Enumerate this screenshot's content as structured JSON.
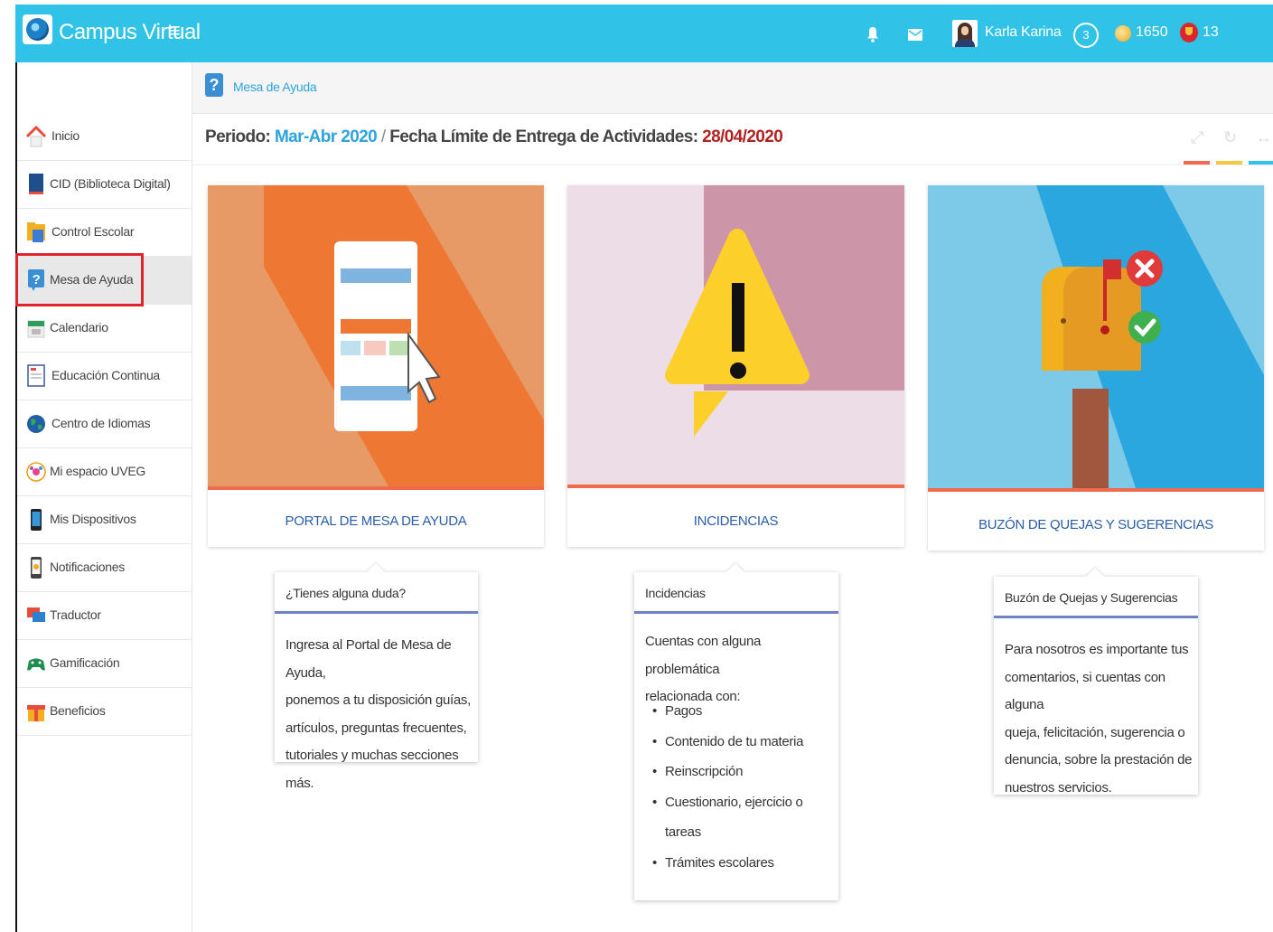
{
  "header": {
    "app_title": "Campus Virtual",
    "user_name": "Karla Karina",
    "level": "3",
    "coins": "1650",
    "trophies": "13"
  },
  "sidebar": {
    "items": [
      {
        "label": "Inicio",
        "icon": "home-icon"
      },
      {
        "label": "CID (Biblioteca Digital)",
        "icon": "book-icon"
      },
      {
        "label": "Control Escolar",
        "icon": "folder-icon"
      },
      {
        "label": "Mesa de Ayuda",
        "icon": "help-icon",
        "active": true
      },
      {
        "label": "Calendario",
        "icon": "calendar-icon"
      },
      {
        "label": "Educación Continua",
        "icon": "certificate-icon"
      },
      {
        "label": "Centro de Idiomas",
        "icon": "globe-icon"
      },
      {
        "label": "Mi espacio UVEG",
        "icon": "community-icon"
      },
      {
        "label": "Mis Dispositivos",
        "icon": "phone-icon"
      },
      {
        "label": "Notificaciones",
        "icon": "notification-icon"
      },
      {
        "label": "Traductor",
        "icon": "chat-icon"
      },
      {
        "label": "Gamificación",
        "icon": "gamepad-icon"
      },
      {
        "label": "Beneficios",
        "icon": "gift-icon"
      }
    ]
  },
  "breadcrumb": {
    "label": "Mesa de Ayuda"
  },
  "period": {
    "prefix": "Periodo:",
    "period_value": "Mar-Abr 2020",
    "separator": "/",
    "deadline_label": "Fecha Límite de Entrega de Actividades:",
    "deadline_value": "28/04/2020"
  },
  "cards": [
    {
      "caption": "PORTAL DE MESA DE AYUDA"
    },
    {
      "caption": "INCIDENCIAS"
    },
    {
      "caption": "BUZÓN DE QUEJAS Y SUGERENCIAS"
    }
  ],
  "popovers": {
    "portal": {
      "title": "¿Tienes alguna duda?",
      "lines": [
        "Ingresa al Portal de Mesa de Ayuda,",
        "ponemos a tu disposición guías,",
        "artículos, preguntas frecuentes,",
        "tutoriales y muchas secciones más."
      ]
    },
    "incidencias": {
      "title": "Incidencias",
      "lines": [
        "Cuentas con alguna problemática",
        "relacionada con:"
      ],
      "bullets": [
        "Pagos",
        "Contenido de tu materia",
        "Reinscripción",
        "Cuestionario, ejercicio o",
        "tareas",
        "Trámites escolares"
      ]
    },
    "buzon": {
      "title": "Buzón de Quejas y Sugerencias",
      "lines": [
        "Para nosotros es importante tus",
        "comentarios, si cuentas con alguna",
        "queja, felicitación, sugerencia o",
        "denuncia, sobre la prestación de",
        "nuestros servicios."
      ]
    }
  },
  "colors": {
    "topbar": "#31c2e8",
    "accent_blue": "#2fa3dc",
    "deadline_red": "#b22222",
    "highlight": "#e0242e"
  }
}
